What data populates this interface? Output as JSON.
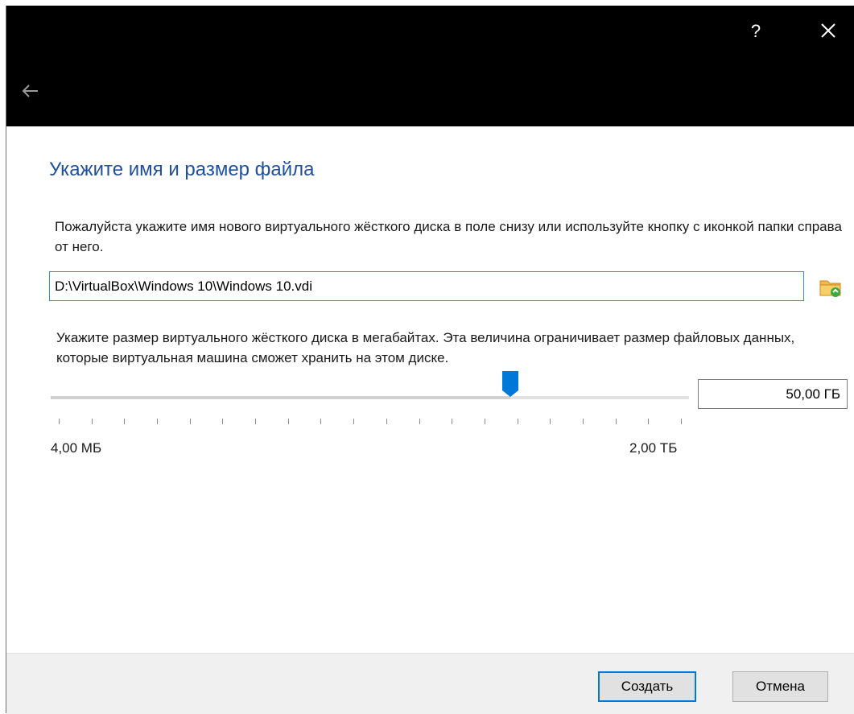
{
  "titlebar": {
    "help_label": "?",
    "close_icon": "close-icon",
    "back_icon": "back-arrow-icon"
  },
  "heading": "Укажите имя и размер файла",
  "file_description": "Пожалуйста укажите имя нового виртуального жёсткого диска в поле снизу или используйте кнопку с иконкой папки справа от него.",
  "file_path": {
    "value": "D:\\VirtualBox\\Windows 10\\Windows 10.vdi",
    "browse_icon": "folder-browse-icon"
  },
  "size_description": "Укажите размер виртуального жёсткого диска в мегабайтах. Эта величина ограничивает размер файловых данных, которые виртуальная машина сможет хранить на этом диске.",
  "size": {
    "value": "50,00 ГБ",
    "min_label": "4,00 МБ",
    "max_label": "2,00 ТБ",
    "slider_position": 0.72
  },
  "buttons": {
    "create": "Создать",
    "cancel": "Отмена"
  },
  "colors": {
    "accent": "#0078d7",
    "heading": "#1f4f9f",
    "titlebar": "#000000"
  }
}
